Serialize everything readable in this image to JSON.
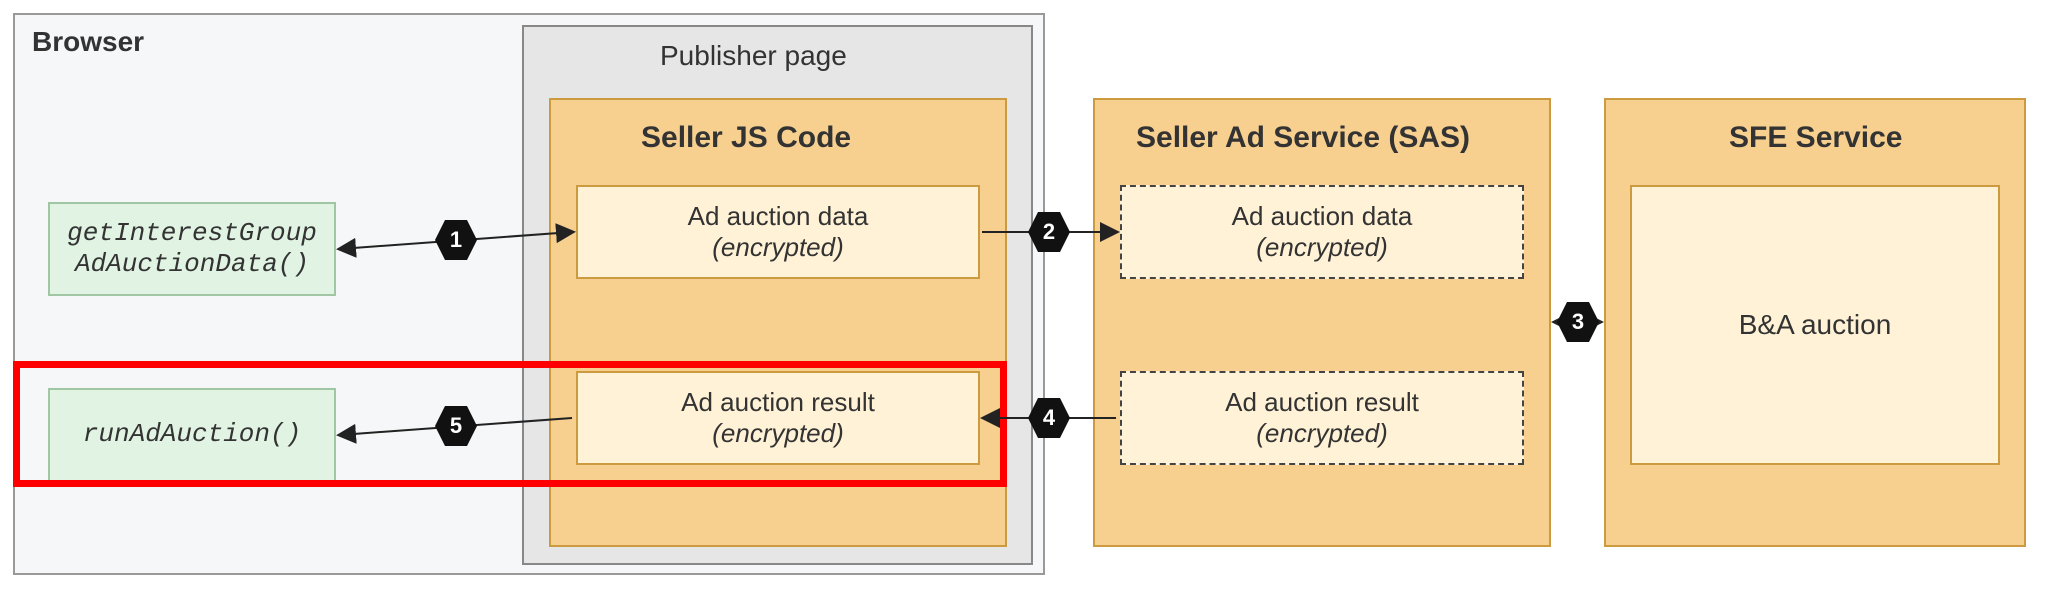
{
  "browser_label": "Browser",
  "publisher_label": "Publisher page",
  "seller_js_label": "Seller JS Code",
  "api1_line1": "getInterestGroup",
  "api1_line2": "AdAuctionData()",
  "api2": "runAdAuction()",
  "box_data_label": "Ad auction data",
  "box_result_label": "Ad auction result",
  "encrypted": "(encrypted)",
  "sas_label": "Seller Ad Service (SAS)",
  "sfe_label": "SFE Service",
  "ba_label": "B&A auction",
  "steps": {
    "s1": "1",
    "s2": "2",
    "s3": "3",
    "s4": "4",
    "s5": "5"
  }
}
